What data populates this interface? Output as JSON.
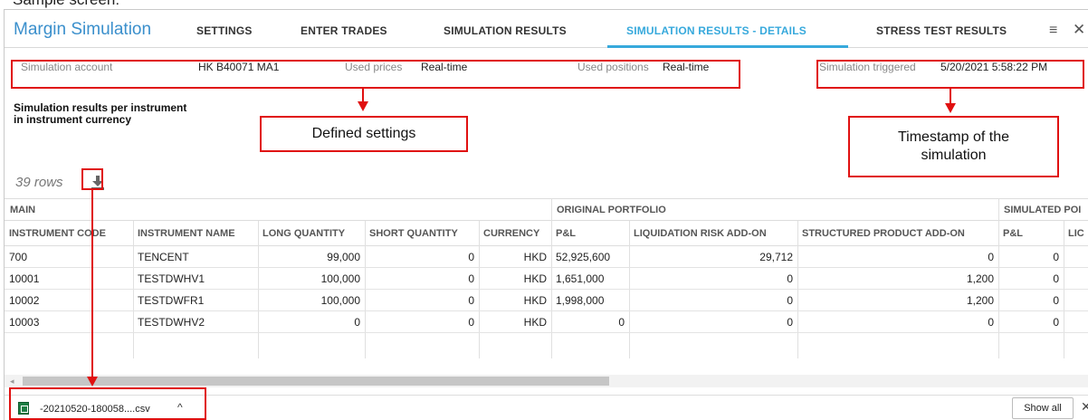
{
  "caption": "Sample screen:",
  "app_title": "Margin Simulation",
  "tabs": [
    {
      "label": "SETTINGS",
      "active": false
    },
    {
      "label": "ENTER TRADES",
      "active": false
    },
    {
      "label": "SIMULATION RESULTS",
      "active": false
    },
    {
      "label": "SIMULATION RESULTS - DETAILS",
      "active": true
    },
    {
      "label": "STRESS TEST RESULTS",
      "active": false
    }
  ],
  "icons": {
    "menu": "hamburger-icon",
    "close": "close-icon",
    "download": "download-icon",
    "csv": "csv-file-icon"
  },
  "settings": {
    "account_label": "Simulation account",
    "account_value": "HK B40071 MA1",
    "prices_label": "Used prices",
    "prices_value": "Real-time",
    "positions_label": "Used positions",
    "positions_value": "Real-time",
    "triggered_label": "Simulation triggered",
    "triggered_value": "5/20/2021 5:58:22 PM"
  },
  "callouts": {
    "defined_settings": "Defined settings",
    "timestamp": "Timestamp of the simulation"
  },
  "section_title": "Simulation results per instrument in instrument currency",
  "rows_count": "39 rows",
  "grid": {
    "groups": [
      "MAIN",
      "ORIGINAL PORTFOLIO",
      "SIMULATED POI"
    ],
    "columns": [
      "INSTRUMENT CODE",
      "INSTRUMENT NAME",
      "LONG QUANTITY",
      "SHORT QUANTITY",
      "CURRENCY",
      "P&L",
      "LIQUIDATION RISK ADD-ON",
      "STRUCTURED PRODUCT ADD-ON",
      "P&L",
      "LIC"
    ],
    "rows": [
      [
        "700",
        "TENCENT",
        "99,000",
        "0",
        "HKD",
        "52,925,600",
        "29,712",
        "0",
        "0",
        ""
      ],
      [
        "10001",
        "TESTDWHV1",
        "100,000",
        "0",
        "HKD",
        "1,651,000",
        "0",
        "1,200",
        "0",
        ""
      ],
      [
        "10002",
        "TESTDWFR1",
        "100,000",
        "0",
        "HKD",
        "1,998,000",
        "0",
        "1,200",
        "0",
        ""
      ],
      [
        "10003",
        "TESTDWHV2",
        "0",
        "0",
        "HKD",
        "0",
        "0",
        "0",
        "0",
        ""
      ]
    ]
  },
  "download_bar": {
    "file_name": "-20210520-180058....csv",
    "show_all": "Show all"
  },
  "colors": {
    "accent": "#37a9dc",
    "annotation": "#e01010"
  }
}
